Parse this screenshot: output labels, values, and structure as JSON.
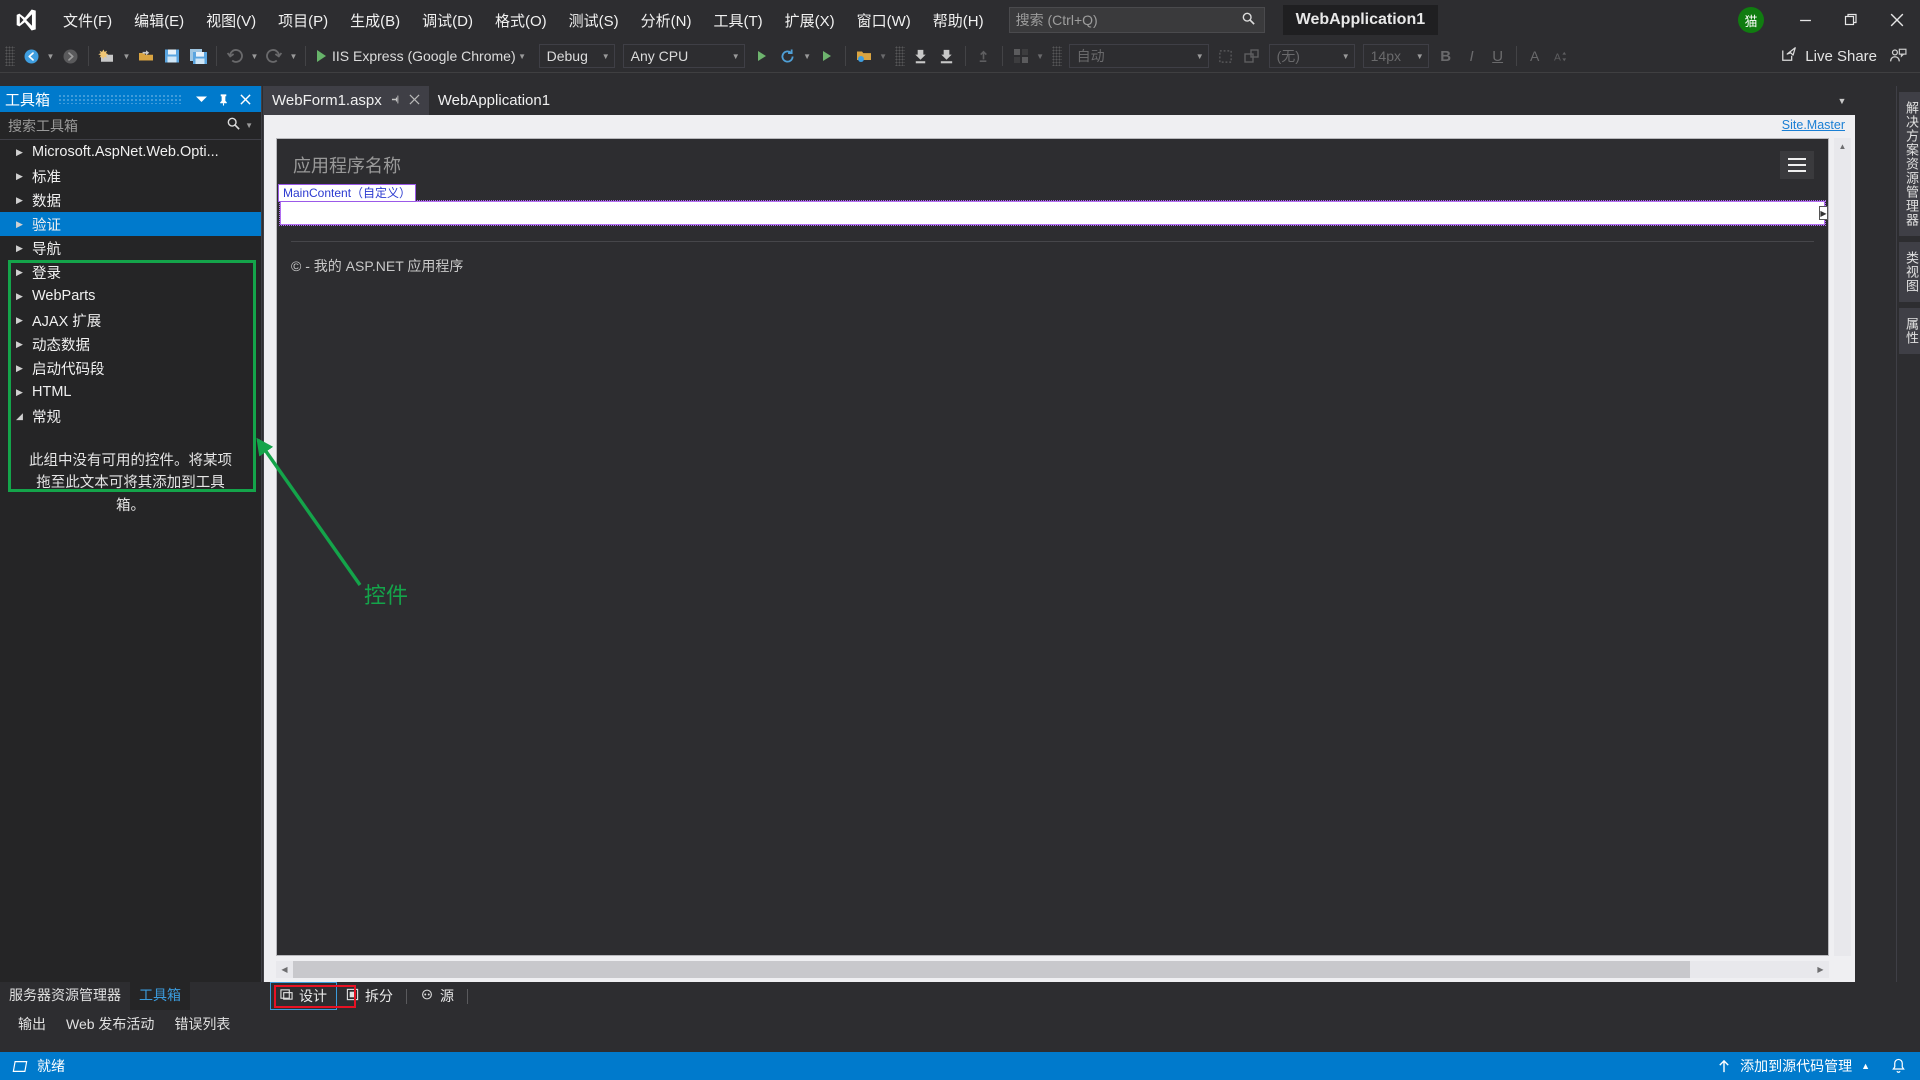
{
  "window": {
    "project_badge": "WebApplication1",
    "avatar_initial": "猫",
    "minimize": "—",
    "maximize": "❐",
    "close": "✕"
  },
  "menu": {
    "items": [
      {
        "label": "文件(F)",
        "name": "menu-file"
      },
      {
        "label": "编辑(E)",
        "name": "menu-edit"
      },
      {
        "label": "视图(V)",
        "name": "menu-view"
      },
      {
        "label": "项目(P)",
        "name": "menu-project"
      },
      {
        "label": "生成(B)",
        "name": "menu-build"
      },
      {
        "label": "调试(D)",
        "name": "menu-debug"
      },
      {
        "label": "格式(O)",
        "name": "menu-format"
      },
      {
        "label": "测试(S)",
        "name": "menu-test"
      },
      {
        "label": "分析(N)",
        "name": "menu-analyze"
      },
      {
        "label": "工具(T)",
        "name": "menu-tools"
      },
      {
        "label": "扩展(X)",
        "name": "menu-extensions"
      },
      {
        "label": "窗口(W)",
        "name": "menu-window"
      },
      {
        "label": "帮助(H)",
        "name": "menu-help"
      }
    ]
  },
  "search": {
    "placeholder": "搜索 (Ctrl+Q)",
    "value": ""
  },
  "toolbar": {
    "run_target": "IIS Express (Google Chrome)",
    "configuration": "Debug",
    "platform": "Any CPU",
    "auto_combo": "自动",
    "style_combo": "(无)",
    "font_size_combo": "14px",
    "bold": "B",
    "italic": "I",
    "underline": "U",
    "live_share": "Live Share"
  },
  "toolbox": {
    "title": "工具箱",
    "search_placeholder": "搜索工具箱",
    "items": [
      {
        "label": "Microsoft.AspNet.Web.Opti...",
        "expanded": false,
        "selected": false
      },
      {
        "label": "标准",
        "expanded": false,
        "selected": false
      },
      {
        "label": "数据",
        "expanded": false,
        "selected": false
      },
      {
        "label": "验证",
        "expanded": false,
        "selected": true
      },
      {
        "label": "导航",
        "expanded": false,
        "selected": false
      },
      {
        "label": "登录",
        "expanded": false,
        "selected": false
      },
      {
        "label": "WebParts",
        "expanded": false,
        "selected": false
      },
      {
        "label": "AJAX 扩展",
        "expanded": false,
        "selected": false
      },
      {
        "label": "动态数据",
        "expanded": false,
        "selected": false
      },
      {
        "label": "启动代码段",
        "expanded": false,
        "selected": false
      },
      {
        "label": "HTML",
        "expanded": false,
        "selected": false
      },
      {
        "label": "常规",
        "expanded": true,
        "selected": false
      }
    ],
    "empty_message": "此组中没有可用的控件。将某项拖至此文本可将其添加到工具箱。"
  },
  "left_bottom_tabs": [
    {
      "label": "服务器资源管理器",
      "active": false
    },
    {
      "label": "工具箱",
      "active": true
    }
  ],
  "bottom_panel_tabs": [
    {
      "label": "输出"
    },
    {
      "label": "Web 发布活动"
    },
    {
      "label": "错误列表"
    }
  ],
  "document_tabs": [
    {
      "label": "WebForm1.aspx",
      "active": true,
      "pinned": false
    },
    {
      "label": "WebApplication1",
      "active": false,
      "pinned": false
    }
  ],
  "designer": {
    "master_link": "Site.Master",
    "brand_placeholder": "应用程序名称",
    "content_region_tag": "MainContent（自定义）",
    "footer": "© - 我的 ASP.NET 应用程序"
  },
  "view_tabs": [
    {
      "label": "设计",
      "icon": "design-icon",
      "active": true
    },
    {
      "label": "拆分",
      "icon": "split-icon",
      "active": false
    },
    {
      "label": "源",
      "icon": "source-icon",
      "active": false
    }
  ],
  "right_strip_tabs": [
    {
      "label": "解决方案资源管理器"
    },
    {
      "label": "类视图"
    },
    {
      "label": "属性"
    }
  ],
  "status_bar": {
    "ready": "就绪",
    "source_control": "添加到源代码管理"
  },
  "annotation": {
    "label": "控件",
    "color": "#14a44a",
    "highlight_color": "#e81123"
  }
}
